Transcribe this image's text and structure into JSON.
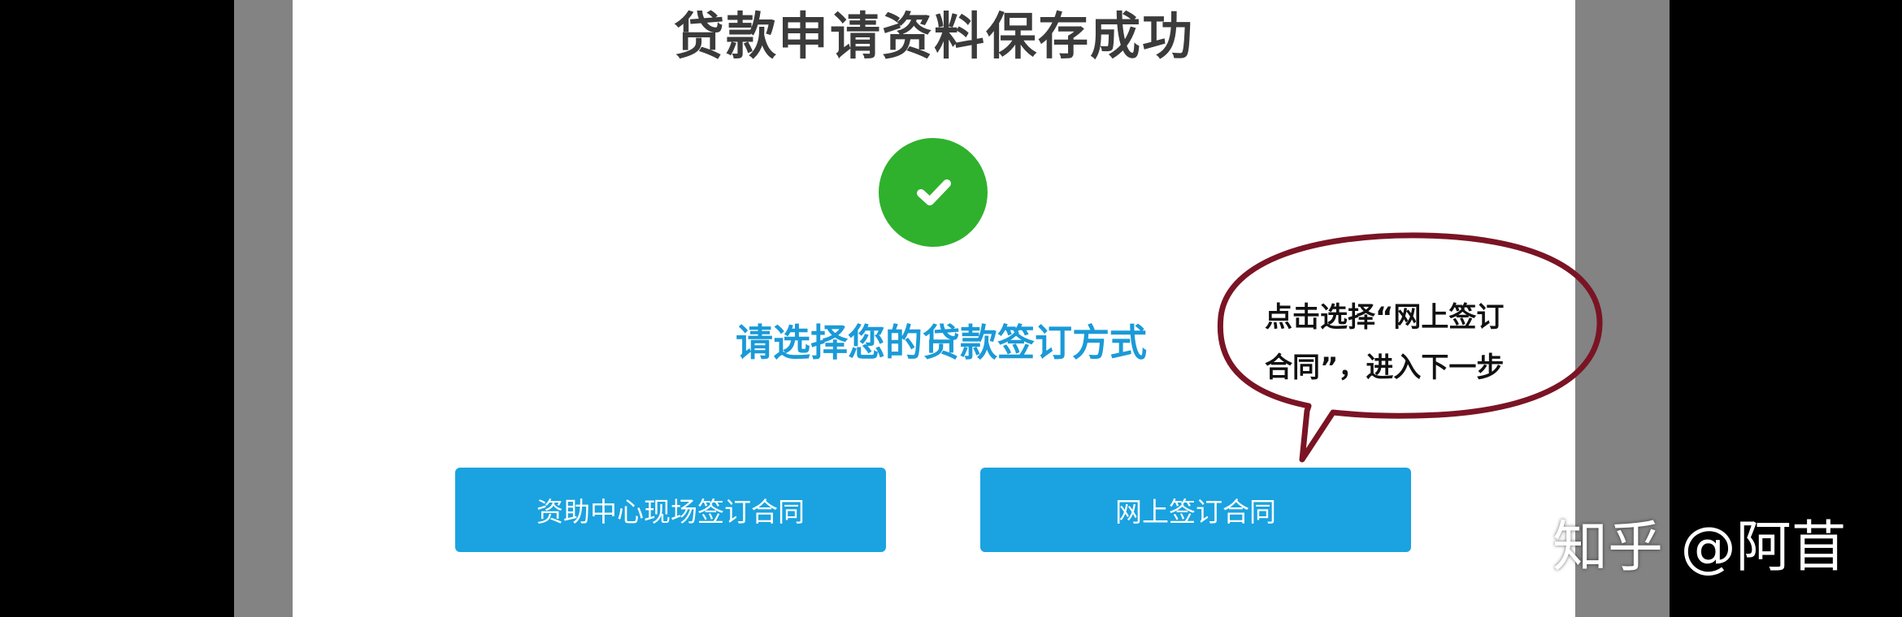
{
  "dialog": {
    "title": "贷款申请资料保存成功",
    "status_icon": "check-icon",
    "prompt": "请选择您的贷款签订方式",
    "options": [
      {
        "label": "资助中心现场签订合同"
      },
      {
        "label": "网上签订合同"
      }
    ]
  },
  "annotation": {
    "line1": "点击选择“网上签订",
    "line2": "合同”，进入下一步"
  },
  "watermark": {
    "text": "知乎 @阿苜"
  },
  "colors": {
    "success_green": "#2fb12d",
    "accent_blue": "#1aa3e0",
    "bubble_outline": "#7a1424"
  }
}
